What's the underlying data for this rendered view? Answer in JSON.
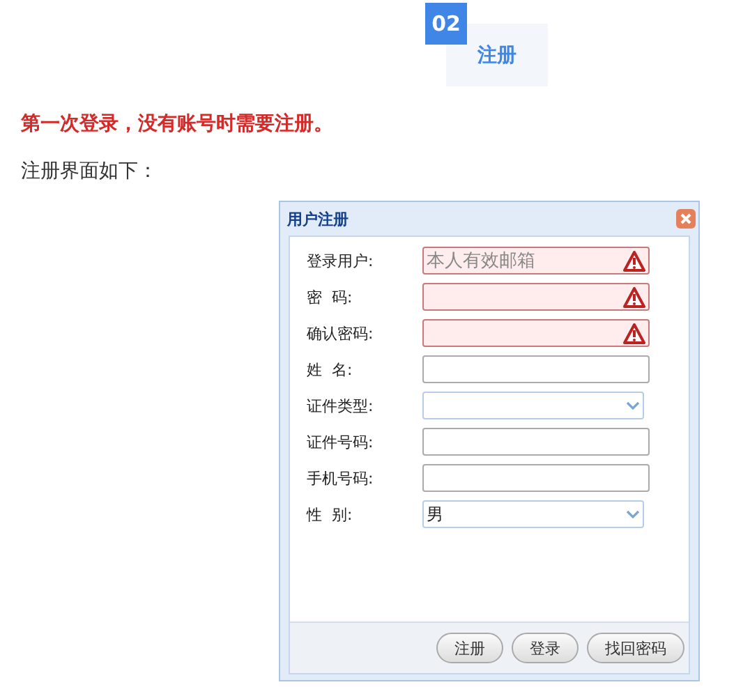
{
  "section": {
    "number": "02",
    "title": "注册"
  },
  "heading": "第一次登录，没有账号时需要注册。",
  "intro": "注册界面如下：",
  "dialog": {
    "title": "用户注册",
    "fields": [
      {
        "label": "登录用户:",
        "kind": "text",
        "error": true,
        "placeholder": "本人有效邮箱"
      },
      {
        "label": "密  码:",
        "kind": "text",
        "error": true
      },
      {
        "label": "确认密码:",
        "kind": "text",
        "error": true
      },
      {
        "label": "姓  名:",
        "kind": "text",
        "error": false
      },
      {
        "label": "证件类型:",
        "kind": "select",
        "error": false
      },
      {
        "label": "证件号码:",
        "kind": "text",
        "error": false
      },
      {
        "label": "手机号码:",
        "kind": "text",
        "error": false
      },
      {
        "label": "性  别:",
        "kind": "select",
        "error": false,
        "value": "男"
      }
    ],
    "buttons": [
      "注册",
      "登录",
      "找回密码"
    ]
  }
}
